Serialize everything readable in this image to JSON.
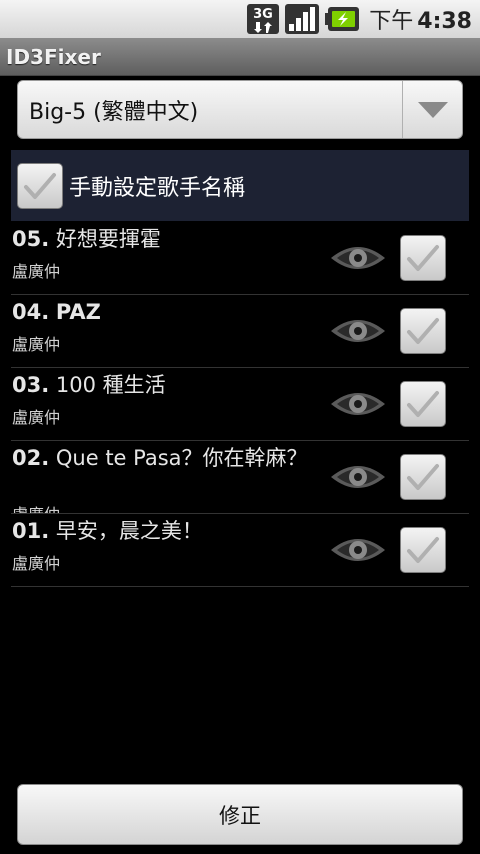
{
  "status_bar": {
    "network_label": "3G",
    "time_period": "下午",
    "time": "4:38"
  },
  "app": {
    "title": "ID3Fixer"
  },
  "encoding_spinner": {
    "selected": "Big-5 (繁體中文)"
  },
  "manual_artist": {
    "label": "手動設定歌手名稱",
    "checked": true
  },
  "tracks": [
    {
      "number": "05.",
      "title": "好想要揮霍",
      "artist": "盧廣仲",
      "checked": true
    },
    {
      "number": "04.",
      "title": "PAZ",
      "artist": "盧廣仲",
      "checked": true
    },
    {
      "number": "03.",
      "title": "100 種生活",
      "artist": "盧廣仲",
      "checked": true
    },
    {
      "number": "02.",
      "title": "Que te Pasa？你在幹麻？",
      "artist": "盧廣仲",
      "checked": true
    },
    {
      "number": "01.",
      "title": "早安，晨之美！",
      "artist": "盧廣仲",
      "checked": true
    }
  ],
  "fix_button": {
    "label": "修正"
  },
  "icons": {
    "network": "3g-data-icon",
    "signal": "signal-strength-icon",
    "battery": "battery-charging-icon",
    "dropdown": "triangle-down-icon",
    "preview": "eye-icon",
    "check": "checkmark-icon"
  },
  "colors": {
    "status_bar": "#e6e6e6",
    "title_bar": "#7a7a7a",
    "manual_row": "#1d2233",
    "battery_green": "#7fd000"
  }
}
